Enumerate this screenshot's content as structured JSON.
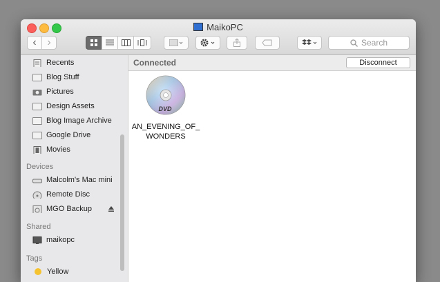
{
  "window": {
    "title": "MaikoPC"
  },
  "toolbar": {
    "back": "‹",
    "forward": "›",
    "search_placeholder": "Search"
  },
  "sidebar": {
    "favorites": [
      {
        "label": "Recents",
        "icon": "recents-icon"
      },
      {
        "label": "Blog Stuff",
        "icon": "folder-icon"
      },
      {
        "label": "Pictures",
        "icon": "camera-icon"
      },
      {
        "label": "Design Assets",
        "icon": "folder-icon"
      },
      {
        "label": "Blog Image Archive",
        "icon": "folder-icon"
      },
      {
        "label": "Google Drive",
        "icon": "folder-icon"
      },
      {
        "label": "Movies",
        "icon": "film-icon"
      }
    ],
    "devices_header": "Devices",
    "devices": [
      {
        "label": "Malcolm's Mac mini",
        "icon": "mac-mini-icon"
      },
      {
        "label": "Remote Disc",
        "icon": "disc-icon"
      },
      {
        "label": "MGO Backup",
        "icon": "drive-icon"
      }
    ],
    "shared_header": "Shared",
    "shared": [
      {
        "label": "maikopc",
        "icon": "monitor-icon"
      }
    ],
    "tags_header": "Tags",
    "tags": [
      {
        "label": "Yellow",
        "color": "#f5c330"
      }
    ]
  },
  "content": {
    "status": "Connected",
    "disconnect_label": "Disconnect",
    "items": [
      {
        "label_line1": "AN_EVENING_OF_",
        "label_line2": "WONDERS",
        "icon": "dvd-disc-icon"
      }
    ]
  }
}
